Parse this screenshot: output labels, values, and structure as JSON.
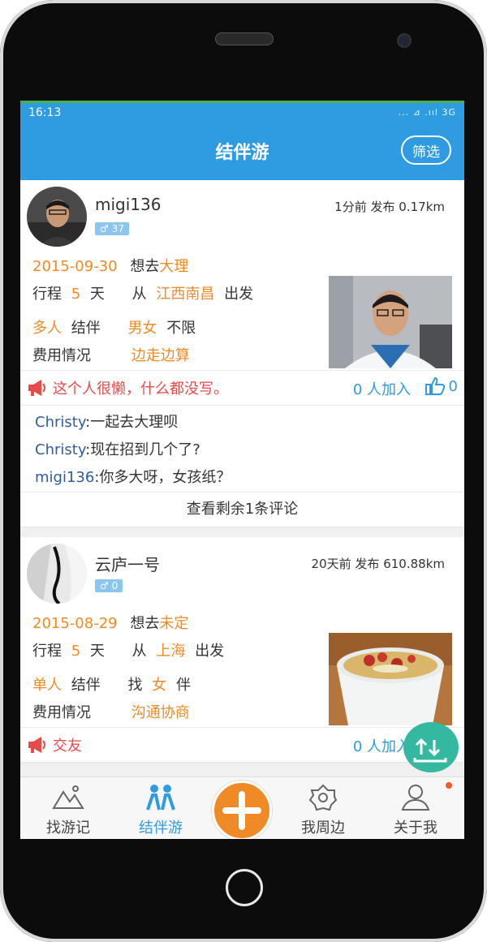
{
  "status": {
    "time": "16:13",
    "right": "... ⊿ .ııl 3G"
  },
  "header": {
    "title": "结伴游",
    "filter_label": "筛选"
  },
  "posts": [
    {
      "username": "migi136",
      "badge": "♂ 37",
      "time_ago": "1分前",
      "publish": "发布",
      "distance": "0.17km",
      "date": "2015-09-30",
      "want_label": "想去",
      "destination": "大理",
      "trip_label": "行程",
      "days": "5",
      "days_unit": "天",
      "from_label": "从",
      "origin": "江西南昌",
      "depart_label": "出发",
      "group": "多人",
      "companion_label": "结伴",
      "gender_want": "男女",
      "gender_limit": "不限",
      "cost_label": "费用情况",
      "cost": "边走边算",
      "slogan": "这个人很懒，什么都没写。",
      "join_text": "0 人加入",
      "likes": "0",
      "comments": [
        {
          "user": "Christy",
          "text": ":一起去大理呗"
        },
        {
          "user": "Christy",
          "text": ":现在招到几个了?"
        },
        {
          "user": "migi136",
          "text": ":你多大呀，女孩纸？"
        }
      ],
      "more_comments": "查看剩余1条评论"
    },
    {
      "username": "云庐一号",
      "badge": "♂ 0",
      "time_ago": "20天前",
      "publish": "发布",
      "distance": "610.88km",
      "date": "2015-08-29",
      "want_label": "想去",
      "destination": "未定",
      "trip_label": "行程",
      "days": "5",
      "days_unit": "天",
      "from_label": "从",
      "origin": "上海",
      "depart_label": "出发",
      "group": "单人",
      "companion_label": "结伴",
      "find_label": "找",
      "gender_want": "女",
      "partner_label": "伴",
      "cost_label": "费用情况",
      "cost": "沟通协商",
      "slogan": "交友",
      "join_text": "0 人加入"
    }
  ],
  "tabs": [
    {
      "label": "找游记",
      "icon": "mountain-icon"
    },
    {
      "label": "结伴游",
      "icon": "people-icon"
    },
    {
      "label": "我周边",
      "icon": "compass-icon"
    },
    {
      "label": "关于我",
      "icon": "person-icon"
    }
  ],
  "colors": {
    "primary": "#2f9be0",
    "accent": "#f08a24",
    "red": "#e84a4a",
    "fab": "#35b8a0"
  }
}
